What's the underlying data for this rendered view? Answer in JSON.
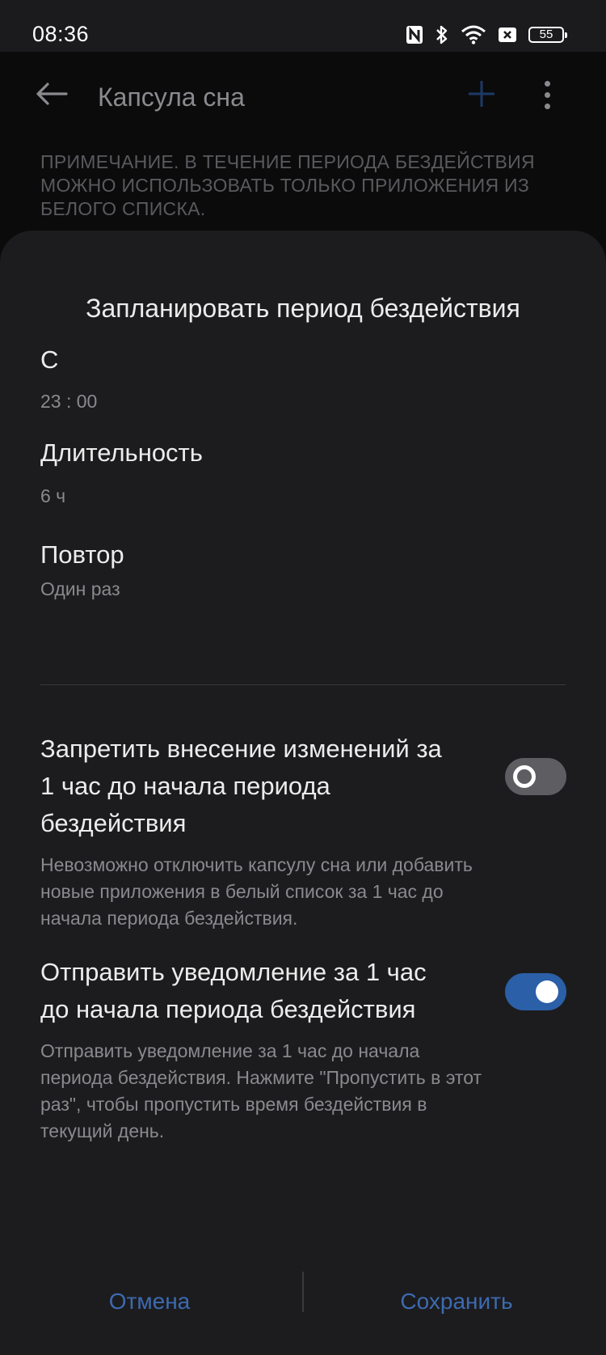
{
  "status_bar": {
    "time": "08:36",
    "icons": [
      "nfc-icon",
      "bluetooth-icon",
      "wifi-icon",
      "sim-none-icon"
    ],
    "battery": "55"
  },
  "app_bar": {
    "title": "Капсула сна",
    "icons": [
      "back-arrow-icon",
      "add-icon",
      "more-vertical-icon"
    ]
  },
  "note": "ПРИМЕЧАНИЕ. В ТЕЧЕНИЕ ПЕРИОДА БЕЗДЕЙСТВИЯ МОЖНО ИСПОЛЬЗОВАТЬ ТОЛЬКО ПРИЛОЖЕНИЯ ИЗ БЕЛОГО СПИСКА.",
  "sheet": {
    "title": "Запланировать период бездействия",
    "start": {
      "label": "С",
      "value": "23 : 00"
    },
    "duration": {
      "label": "Длительность",
      "value": "6 ч"
    },
    "repeat": {
      "label": "Повтор",
      "value": "Один раз"
    },
    "toggles": [
      {
        "title": "Запретить внесение изменений за 1 час до начала периода бездействия",
        "description": "Невозможно отключить капсулу сна или добавить новые приложения в белый список за 1 час до начала периода бездействия.",
        "enabled": false
      },
      {
        "title": "Отправить уведомление за 1 час до начала периода бездействия",
        "description": "Отправить уведомление за 1 час до начала периода бездействия. Нажмите \"Пропустить в этот раз\", чтобы пропустить время бездействия в текущий день.",
        "enabled": true
      }
    ],
    "cancel_label": "Отмена",
    "save_label": "Сохранить"
  },
  "colors": {
    "accent": "#3d6ab0",
    "switch_on": "#2b5fa8",
    "switch_off": "#5e5e62",
    "sheet_background": "#1c1c1e"
  }
}
